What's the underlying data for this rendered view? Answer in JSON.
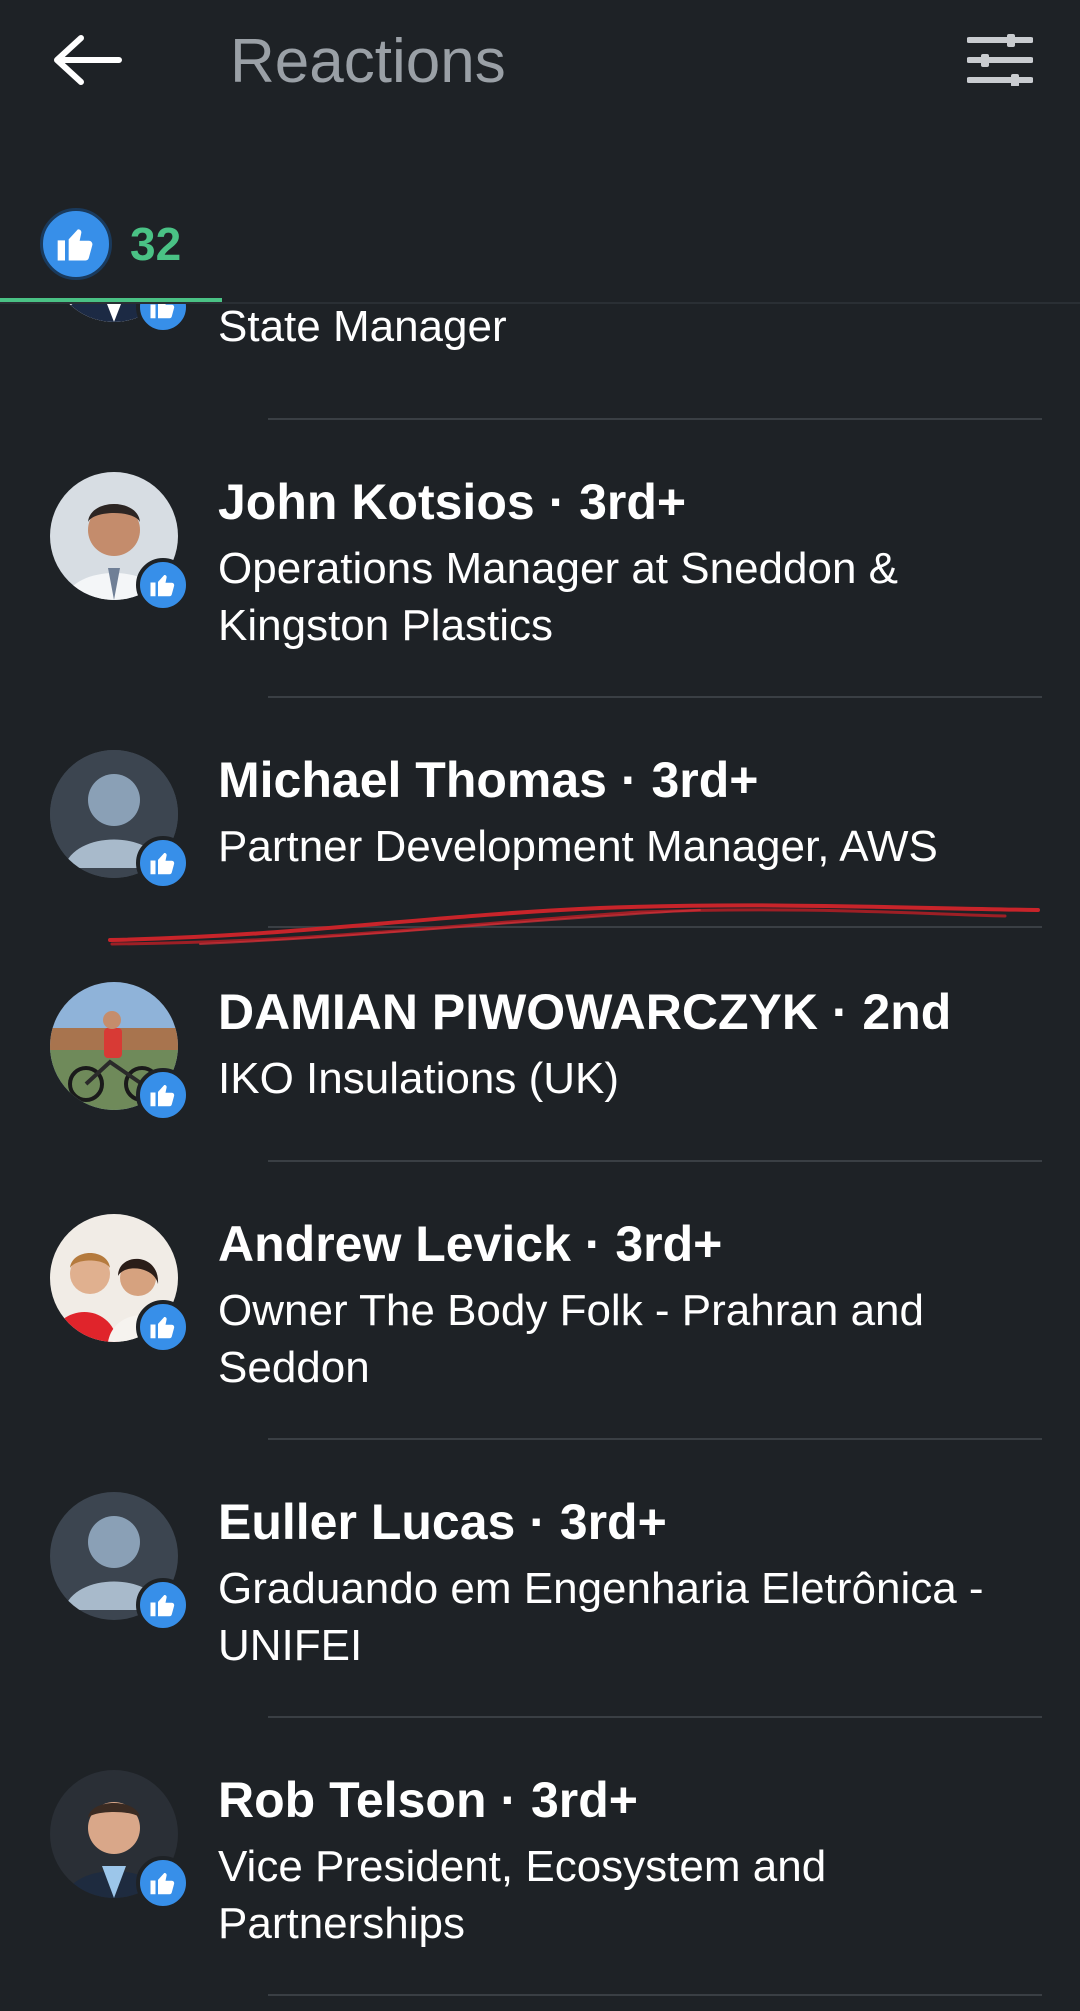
{
  "header": {
    "title": "Reactions"
  },
  "tabs": [
    {
      "count": "32"
    }
  ],
  "reactors": [
    {
      "name": "",
      "separator": "",
      "degree": "",
      "headline": "State Manager"
    },
    {
      "name": "John Kotsios",
      "separator": " · ",
      "degree": "3rd+",
      "headline": "Operations Manager at Sneddon & Kingston Plastics"
    },
    {
      "name": "Michael Thomas",
      "separator": " · ",
      "degree": "3rd+",
      "headline": "Partner Development Manager, AWS"
    },
    {
      "name": "DAMIAN PIWOWARCZYK",
      "separator": " · ",
      "degree": "2nd",
      "headline": "IKO Insulations (UK)"
    },
    {
      "name": "Andrew Levick",
      "separator": " · ",
      "degree": "3rd+",
      "headline": "Owner The Body Folk - Prahran and Seddon"
    },
    {
      "name": "Euller Lucas",
      "separator": " · ",
      "degree": "3rd+",
      "headline": "Graduando em Engenharia Eletrônica - UNIFEI"
    },
    {
      "name": "Rob Telson",
      "separator": " · ",
      "degree": "3rd+",
      "headline": "Vice President, Ecosystem and Partnerships"
    }
  ],
  "icons": {
    "back": "arrow-left-icon",
    "filter": "sliders-icon",
    "reaction": "like-thumbs-up-icon",
    "placeholder_avatar": "person-silhouette-icon"
  },
  "colors": {
    "background": "#1e2226",
    "accent_green": "#4ac285",
    "like_blue": "#378fe9",
    "annotation_red": "#c8242a"
  }
}
